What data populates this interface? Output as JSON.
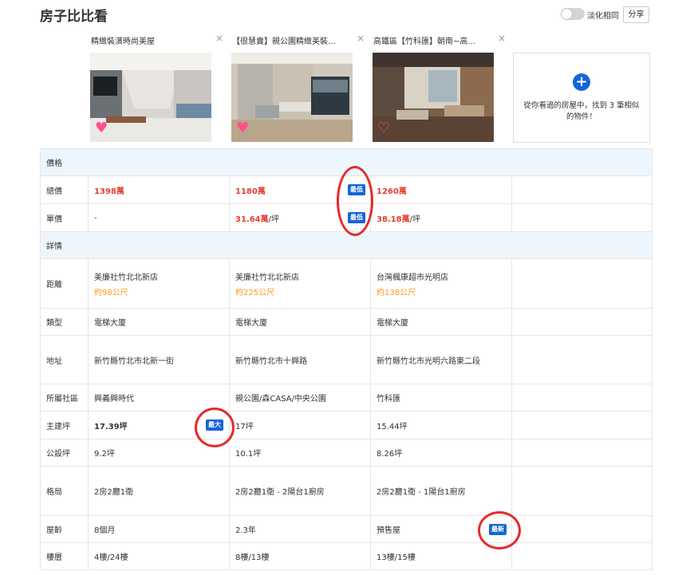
{
  "header": {
    "title": "房子比比看",
    "toggle_label": "淡化相同",
    "share_label": "分享"
  },
  "cards": [
    {
      "title": "精緻裝潢時尚美屋",
      "close": "×"
    },
    {
      "title": "【很慧賣】親公園精緻美裝…",
      "close": "×"
    },
    {
      "title": "高鐵區【竹科匯】朝南~高…",
      "close": "×"
    }
  ],
  "add_card": {
    "icon": "+",
    "text": "從你看過的房屋中，找到 3 筆相似的物件！"
  },
  "sections": {
    "price": "價格",
    "details": "詳情"
  },
  "badges": {
    "lowest": "最低",
    "largest": "最大",
    "newest": "最新"
  },
  "rows": {
    "total": {
      "label": "總價",
      "values": [
        "1398萬",
        "1180萬",
        "1260萬"
      ]
    },
    "unit": {
      "label": "單價",
      "values": [
        "-",
        "31.64萬",
        "38.18萬"
      ],
      "unit_suffix": "/坪"
    },
    "distance": {
      "label": "距離",
      "stores": [
        "美廉社竹北北新店",
        "美廉社竹北北新店",
        "台灣楓康超市光明店"
      ],
      "dists": [
        "約98公尺",
        "約225公尺",
        "約138公尺"
      ]
    },
    "type": {
      "label": "類型",
      "values": [
        "電梯大廈",
        "電梯大廈",
        "電梯大廈"
      ]
    },
    "address": {
      "label": "地址",
      "values": [
        "新竹縣竹北市北新一街",
        "新竹縣竹北市十興路",
        "新竹縣竹北市光明六路東二段"
      ]
    },
    "community": {
      "label": "所屬社區",
      "values": [
        "興義興時代",
        "親公園/森CASA/中央公園",
        "竹科匯"
      ]
    },
    "main_area": {
      "label": "主建坪",
      "values": [
        "17.39坪",
        "17坪",
        "15.44坪"
      ]
    },
    "public_area": {
      "label": "公設坪",
      "values": [
        "9.2坪",
        "10.1坪",
        "8.26坪"
      ]
    },
    "layout": {
      "label": "格局",
      "values": [
        "2房2廳1衛",
        "2房2廳1衛 - 2陽台1廚房",
        "2房2廳1衛 - 1陽台1廚房"
      ]
    },
    "age": {
      "label": "屋齡",
      "values": [
        "8個月",
        "2.3年",
        "預售屋"
      ]
    },
    "floor": {
      "label": "樓層",
      "values": [
        "4樓/24樓",
        "8樓/13樓",
        "13樓/15樓"
      ]
    }
  },
  "colors": {
    "accent": "#1565d8",
    "price_red": "#e64032",
    "distance_orange": "#ff9a1f",
    "section_bg": "#eef6fd",
    "annotation_red": "#e52a2a"
  }
}
